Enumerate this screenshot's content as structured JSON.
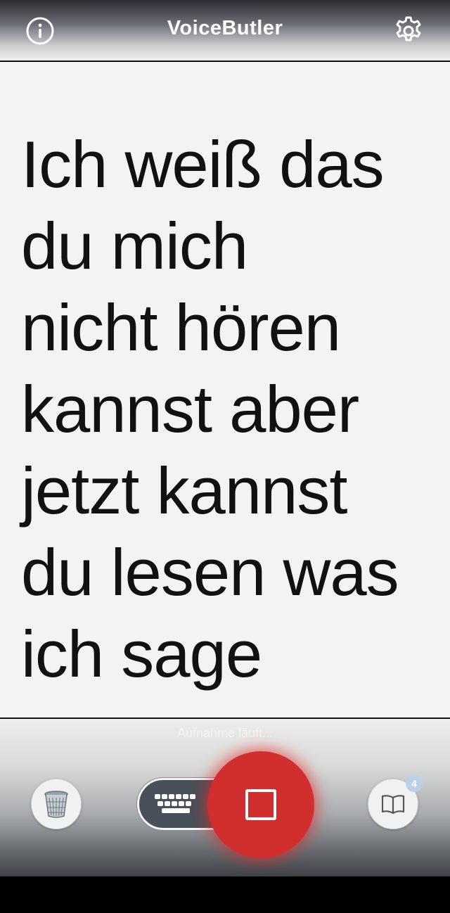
{
  "header": {
    "title": "VoiceButler",
    "info_icon": "info-circle-icon",
    "settings_icon": "gear-icon"
  },
  "transcript": {
    "text": "Ich weiß das\ndu mich\nnicht hören\nkannst aber\njetzt kannst\ndu lesen was\nich sage"
  },
  "bottom_bar": {
    "status_text": "Aufnahme läuft...",
    "trash_icon": "trash-icon",
    "keyboard_icon": "keyboard-icon",
    "stop_icon": "stop-icon",
    "book_icon": "book-icon",
    "book_badge_count": "4"
  },
  "colors": {
    "record_red": "#d12f2f",
    "transcript_bg": "#f3f3f3",
    "badge_blue": "#b9d0e6",
    "keyboard_bg": "#4a5059"
  }
}
